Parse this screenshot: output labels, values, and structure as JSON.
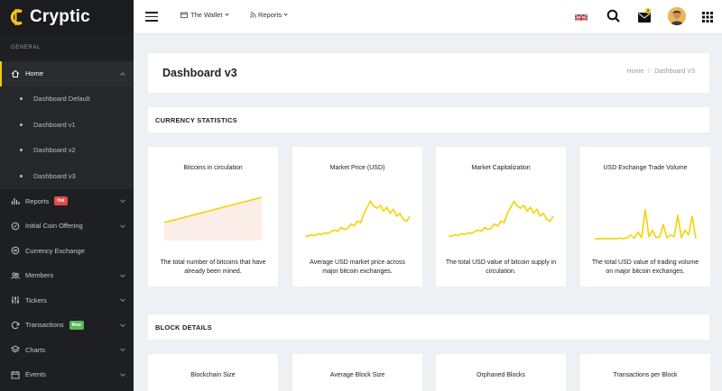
{
  "brand": {
    "name": "Cryptic"
  },
  "sidebar": {
    "section_label": "GENERAL",
    "home": {
      "label": "Home"
    },
    "submenu": [
      "Dashboard Default",
      "Dashboard v1",
      "Dashboard v2",
      "Dashboard v3"
    ],
    "items": [
      {
        "label": "Reports",
        "badge": "Hot"
      },
      {
        "label": "Initial Coin Offering"
      },
      {
        "label": "Currency Exchange"
      },
      {
        "label": "Members"
      },
      {
        "label": "Tickers"
      },
      {
        "label": "Transactions",
        "badge": "New"
      },
      {
        "label": "Charts"
      },
      {
        "label": "Events"
      }
    ]
  },
  "topbar": {
    "wallet_label": "The Wallet",
    "reports_label": "Reports",
    "mail_count": "3"
  },
  "page": {
    "title": "Dashboard v3",
    "breadcrumb": [
      "Home",
      "Dashboard V3"
    ]
  },
  "sections": {
    "currency": "CURRENCY STATISTICS",
    "block": "BLOCK DETAILS"
  },
  "currency_cards": [
    {
      "title": "Bitcoins in circulation",
      "desc": "The total number of bitcoins that have already been mined."
    },
    {
      "title": "Market Price (USD)",
      "desc": "Average USD market price across major bitcoin exchanges."
    },
    {
      "title": "Market Capitalization",
      "desc": "The total USD value of bitcoin supply in circulation."
    },
    {
      "title": "USD Exchange Trade Volume",
      "desc": "The total USD value of trading volume on major bitcoin exchanges."
    }
  ],
  "block_cards": [
    {
      "title": "Blockchain Size"
    },
    {
      "title": "Average Block Size"
    },
    {
      "title": "Orphaned Blocks"
    },
    {
      "title": "Transactions per Block"
    }
  ],
  "colors": {
    "accent": "#f5d300",
    "sidebar_bg": "#1d1f22",
    "hot": "#e24a4a",
    "new": "#59b75c"
  },
  "chart_data": [
    {
      "type": "area",
      "name": "Bitcoins in circulation",
      "values": [
        10,
        11.4,
        12.8,
        14.2,
        15.6,
        17.0,
        18.4,
        19.8,
        21.2,
        22.6,
        24.0
      ]
    },
    {
      "type": "line",
      "name": "Market Price (USD)",
      "values": [
        2,
        2.3,
        2.8,
        2.5,
        3.4,
        3.0,
        3.8,
        3.5,
        4.4,
        5.2,
        4.6,
        6.5,
        5.5,
        6.0,
        8.2,
        7.2,
        9.6,
        8.8,
        13.5,
        16.5,
        19.5,
        17.0,
        16.0,
        17.5,
        14.5,
        16.5,
        13.5,
        15.5,
        12.0,
        13.5,
        10.5,
        9.5,
        12.0
      ]
    },
    {
      "type": "line",
      "name": "Market Capitalization",
      "values": [
        2,
        2.3,
        2.8,
        2.5,
        3.4,
        3.0,
        3.8,
        3.5,
        4.4,
        5.2,
        4.6,
        6.5,
        5.5,
        6.0,
        8.2,
        7.2,
        9.6,
        8.8,
        13.5,
        16.5,
        19.5,
        17.0,
        16.0,
        17.5,
        14.5,
        16.5,
        13.5,
        15.5,
        12.0,
        13.5,
        10.5,
        9.5,
        12.0
      ]
    },
    {
      "type": "line",
      "name": "USD Exchange Trade Volume",
      "values": [
        1,
        1,
        1,
        1,
        1,
        1,
        1,
        1.3,
        1.0,
        1.5,
        3.0,
        1.2,
        4.5,
        1.5,
        16.5,
        2.0,
        5.5,
        1.5,
        2.0,
        8.5,
        1.5,
        3.0,
        2.0,
        13.5,
        1.5,
        5.5,
        3.0,
        13.0,
        1.0
      ]
    }
  ]
}
